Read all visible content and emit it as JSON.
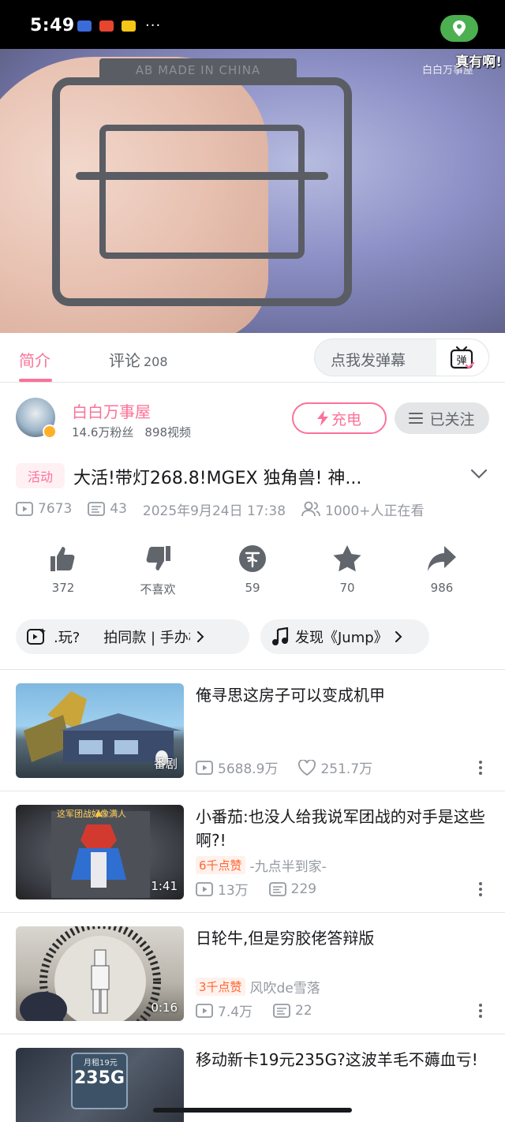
{
  "status_bar": {
    "time": "5:49",
    "app_icon_colors": [
      "#3a6bd8",
      "#e8452f",
      "#f5c518"
    ],
    "more": "···",
    "location_color": "#4caf50"
  },
  "video": {
    "watermark": "白白万事屋",
    "danmaku": "真有啊!",
    "runner_text": "AB   MADE IN CHINA"
  },
  "tabs": {
    "intro": "简介",
    "comments": "评论",
    "comments_count": "208",
    "danmaku_placeholder": "点我发弹幕",
    "danmaku_button_icon": "danmaku-icon"
  },
  "uploader": {
    "name": "白白万事屋",
    "fans": "14.6万粉丝",
    "videos": "898视频",
    "charge_label": "充电",
    "follow_label": "已关注"
  },
  "video_info": {
    "activity_tag": "活动",
    "title": "大活!带灯268.8!MGEX 独角兽! 神...",
    "plays": "7673",
    "danmaku_count": "43",
    "date": "2025年9月24日 17:38",
    "watching": "1000+人正在看"
  },
  "actions": [
    {
      "icon": "thumbs-up-icon",
      "label": "372"
    },
    {
      "icon": "thumbs-down-icon",
      "label": "不喜欢"
    },
    {
      "icon": "coin-icon",
      "label": "59"
    },
    {
      "icon": "star-icon",
      "label": "70"
    },
    {
      "icon": "share-icon",
      "label": "986"
    }
  ],
  "chips": {
    "play": ".玩?",
    "shoot": "拍同款 | 手办模玩",
    "music": "发现《Jump》"
  },
  "recommendations": [
    {
      "title": "俺寻思这房子可以变成机甲",
      "badge": "番剧",
      "plays": "5688.9万",
      "likes": "251.7万"
    },
    {
      "title": "小番茄:也没人给我说军团战的对手是这些啊?!",
      "duration": "1:41",
      "likes_badge": "6千点赞",
      "author": "-九点半到家-",
      "plays": "13万",
      "danmaku": "229",
      "thumb_caption": "这军团战好像满人"
    },
    {
      "title": "日轮牛,但是穷胶佬答辩版",
      "duration": "0:16",
      "likes_badge": "3千点赞",
      "author": "风吹de雪落",
      "plays": "7.4万",
      "danmaku": "22"
    },
    {
      "title": "移动新卡19元235G?这波羊毛不薅血亏!",
      "thumb_text": "235G",
      "thumb_sub": "月租19元"
    }
  ],
  "colors": {
    "accent": "#fb7299",
    "text": "#18191c",
    "secondary": "#61666d",
    "muted": "#9499a0"
  }
}
